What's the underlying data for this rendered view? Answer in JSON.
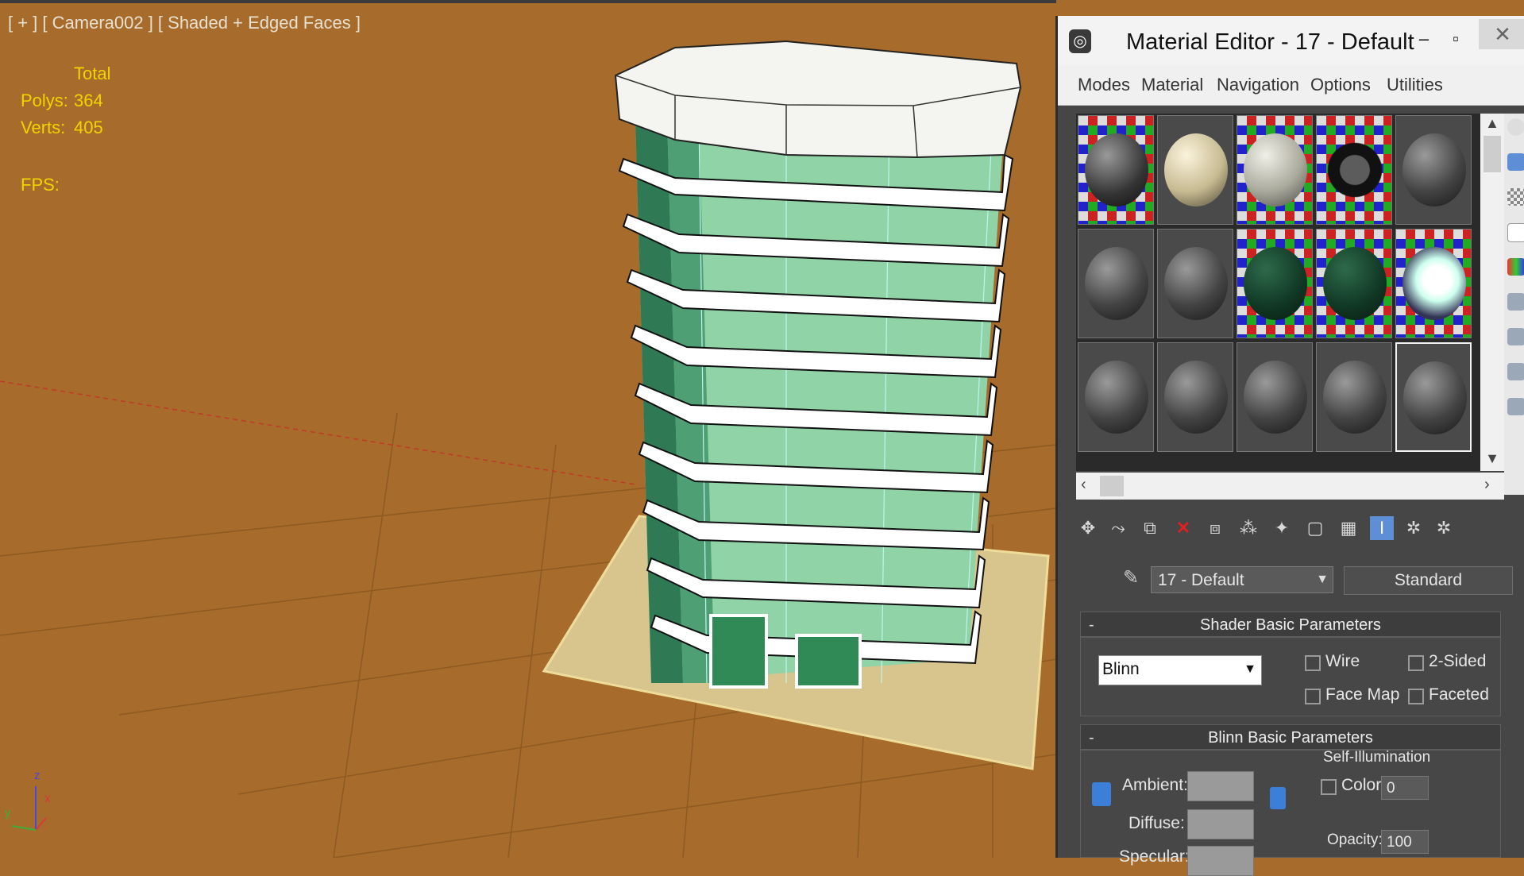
{
  "viewport": {
    "label": "[ + ] [ Camera002 ] [ Shaded + Edged Faces ]",
    "stats": {
      "total_header": "Total",
      "polys_label": "Polys:",
      "polys_value": "364",
      "verts_label": "Verts:",
      "verts_value": "405",
      "fps_label": "FPS:"
    },
    "axis": {
      "x": "x",
      "y": "y",
      "z": "z"
    },
    "colors": {
      "background": "#a76b2b",
      "glass": "#8fd3a6",
      "floor_slab": "#ffffff",
      "ground_plane": "#d6c28a"
    }
  },
  "material_editor": {
    "title": "Material Editor - 17 - Default",
    "menu": [
      "Modes",
      "Material",
      "Navigation",
      "Options",
      "Utilities"
    ],
    "slots": [
      [
        "checker-dark",
        "cream",
        "checker-grey",
        "checker-ring",
        "grey"
      ],
      [
        "grey",
        "grey",
        "checker-green",
        "checker-green",
        "checker-bright"
      ],
      [
        "grey",
        "grey",
        "grey",
        "grey",
        "grey-active"
      ]
    ],
    "material_name": "17 - Default",
    "material_type": "Standard",
    "shader_rollout": {
      "title": "Shader Basic Parameters",
      "shader": "Blinn",
      "wire": "Wire",
      "two_sided": "2-Sided",
      "face_map": "Face Map",
      "faceted": "Faceted"
    },
    "blinn_rollout": {
      "title": "Blinn Basic Parameters",
      "ambient": "Ambient:",
      "diffuse": "Diffuse:",
      "specular": "Specular:",
      "self_illum": "Self-Illumination",
      "color_label": "Color",
      "color_value": "0",
      "opacity_label": "Opacity:",
      "opacity_value": "100"
    }
  }
}
